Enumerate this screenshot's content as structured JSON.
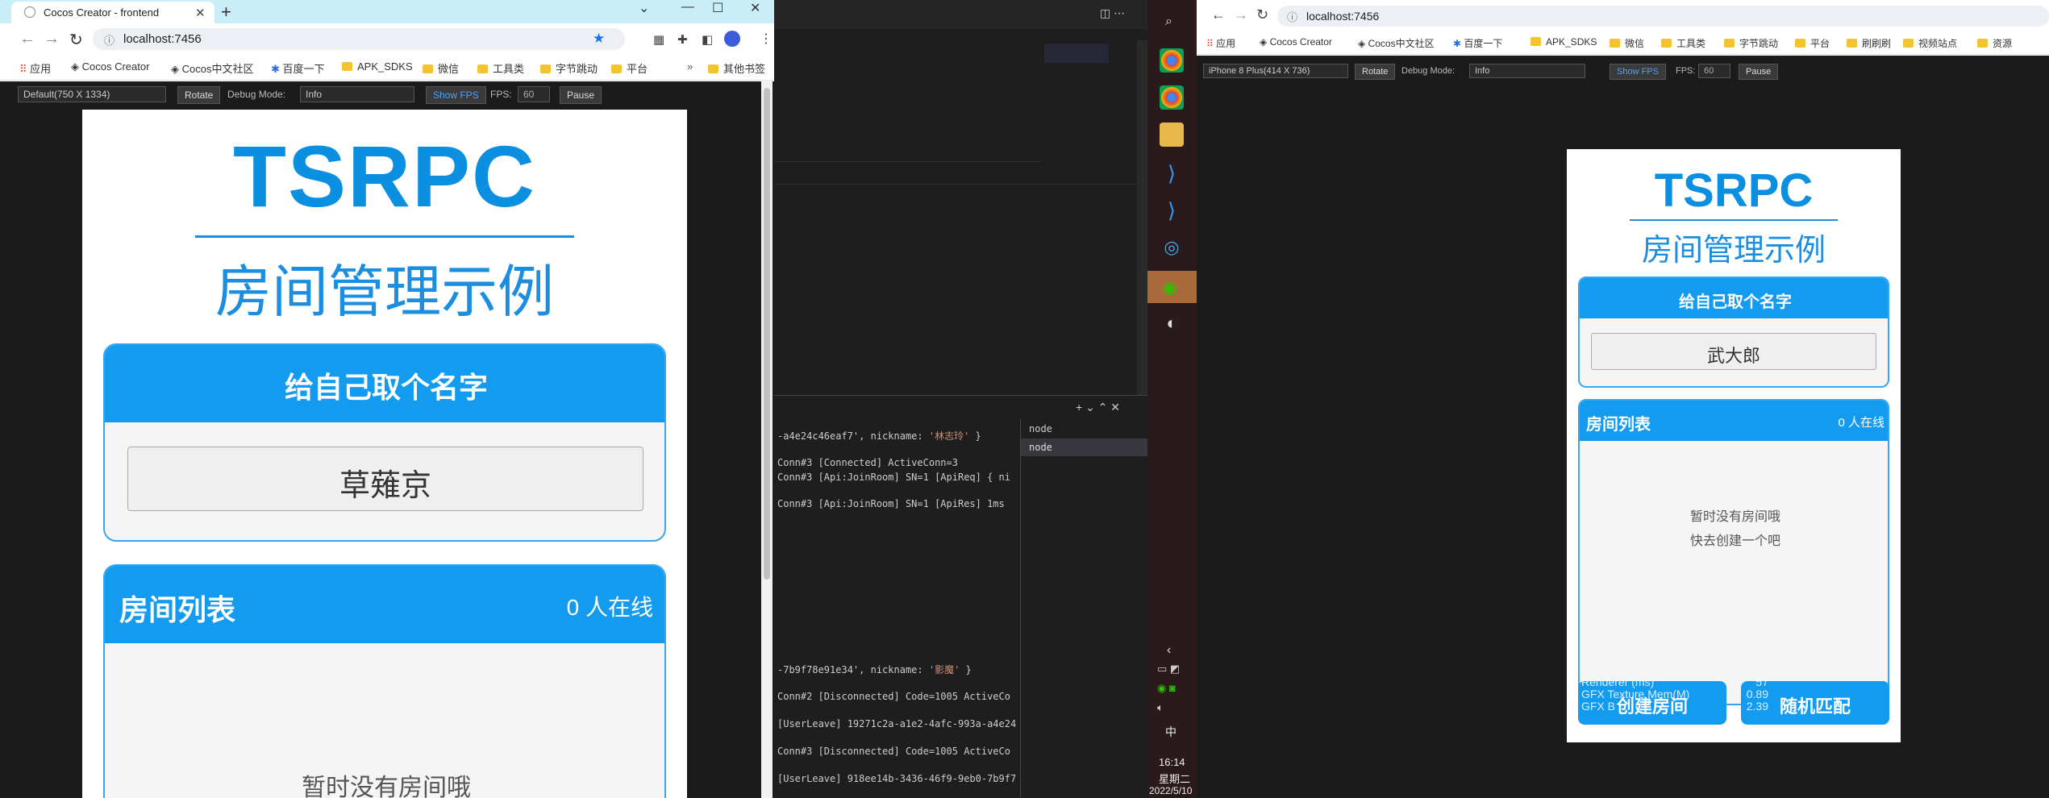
{
  "left_browser": {
    "tab_title": "Cocos Creator - frontend",
    "url": "localhost:7456",
    "bookmarks": [
      "应用",
      "Cocos Creator",
      "Cocos中文社区",
      "百度一下",
      "APK_SDKS",
      "微信",
      "工具类",
      "字节跳动",
      "平台",
      "其他书签"
    ],
    "toolbar": {
      "device": "Default(750 X 1334)",
      "rotate": "Rotate",
      "debug_label": "Debug Mode:",
      "debug_value": "Info",
      "show_fps": "Show FPS",
      "fps_label": "FPS:",
      "fps_value": "60",
      "pause": "Pause"
    },
    "game": {
      "title": "TSRPC",
      "subtitle": "房间管理示例",
      "name_header": "给自己取个名字",
      "name_value": "草薙京",
      "room_header": "房间列表",
      "online": "0 人在线",
      "empty_line1": "暂时没有房间哦"
    }
  },
  "editor": {
    "lines": [
      {
        "pre": "-a4e24c46eaf7', nickname: ",
        "str": "'林志玲'",
        "post": " }"
      },
      {
        "pre": "Conn#3 [Connected] ActiveConn=3"
      },
      {
        "pre": "Conn#3 [Api:JoinRoom] SN=1 [ApiReq] { ni"
      },
      {
        "pre": "Conn#3 [Api:JoinRoom] SN=1 [ApiRes] 1ms"
      },
      {
        "pre": "-7b9f78e91e34', nickname: ",
        "str": "'影魔'",
        "post": " }"
      },
      {
        "pre": "Conn#2 [Disconnected] Code=1005 ActiveCo"
      },
      {
        "pre": "[UserLeave] 19271c2a-a1e2-4afc-993a-a4e24"
      },
      {
        "pre": "Conn#3 [Disconnected] Code=1005 ActiveCo"
      },
      {
        "pre": "[UserLeave] 918ee14b-3436-46f9-9eb0-7b9f7"
      }
    ],
    "terminals": [
      "node",
      "node"
    ],
    "panel_controls": "+ ⌄ ⌃ ✕",
    "codelens": "◫  ⋯"
  },
  "taskbar": {
    "time": "16:14",
    "day": "星期二",
    "date": "2022/5/10",
    "ime": "中"
  },
  "right_browser": {
    "url": "localhost:7456",
    "bookmarks": [
      "应用",
      "Cocos Creator",
      "Cocos中文社区",
      "百度一下",
      "APK_SDKS",
      "微信",
      "工具类",
      "字节跳动",
      "平台",
      "刷刷刷",
      "视频站点",
      "资源"
    ],
    "toolbar": {
      "device": "iPhone 8 Plus(414 X 736)",
      "rotate": "Rotate",
      "debug_label": "Debug Mode:",
      "debug_value": "Info",
      "show_fps": "Show FPS",
      "fps_label": "FPS:",
      "fps_value": "60",
      "pause": "Pause"
    },
    "game": {
      "title": "TSRPC",
      "subtitle": "房间管理示例",
      "name_header": "给自己取个名字",
      "name_value": "武大郎",
      "room_header": "房间列表",
      "online": "0 人在线",
      "empty_line1": "暂时没有房间哦",
      "empty_line2": "快去创建一个吧",
      "create_btn": "创建房间",
      "match_btn": "随机匹配"
    },
    "stats": [
      "Renderer (ms)",
      "GFX Texture Mem(M)",
      "GFX B",
      "57",
      "0.89",
      "2.39"
    ]
  },
  "colors": {
    "accent": "#139bf0",
    "title": "#0b8fe0"
  }
}
